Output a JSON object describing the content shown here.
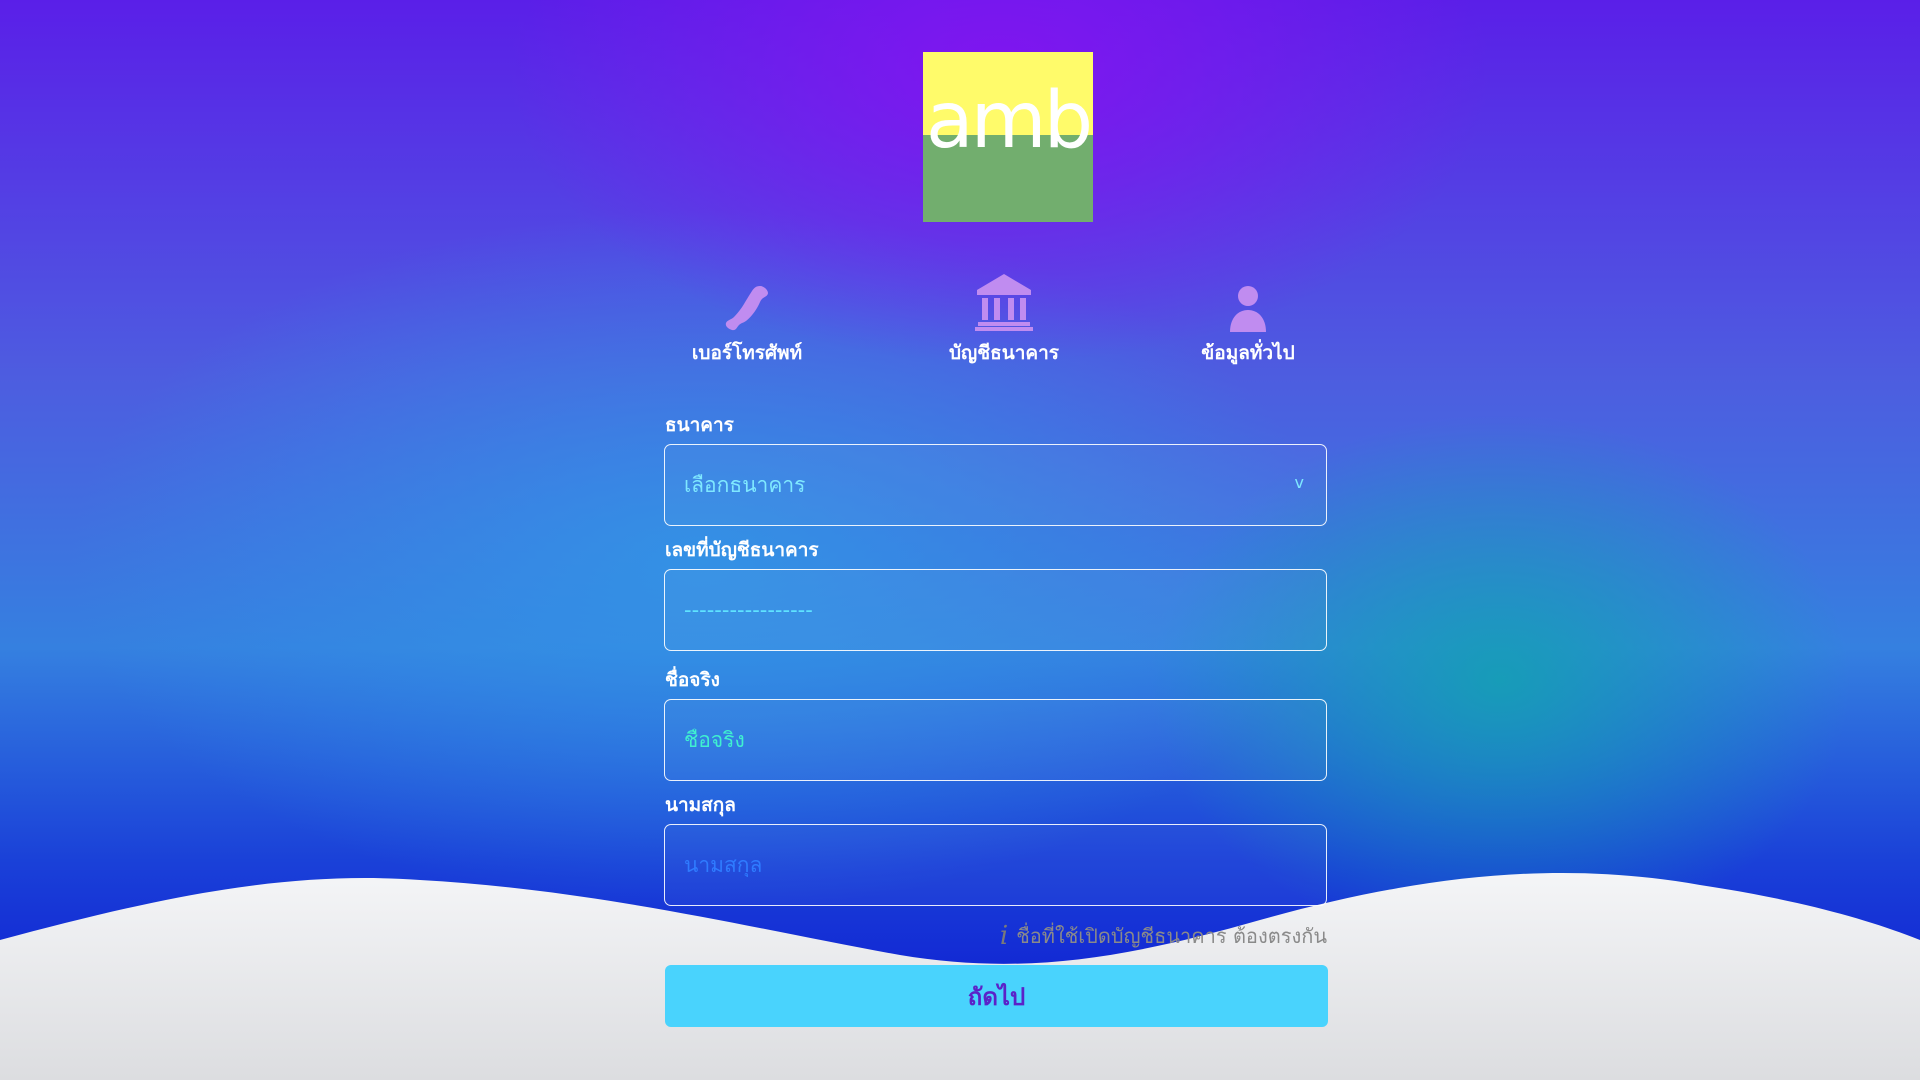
{
  "logo": {
    "text": "amb",
    "color_top": "#fffb6a",
    "color_bottom": "#72ae6e"
  },
  "steps": [
    {
      "label": "เบอร์โทรศัพท์",
      "icon": "phone-icon"
    },
    {
      "label": "บัญชีธนาคาร",
      "icon": "bank-icon"
    },
    {
      "label": "ข้อมูลทั่วไป",
      "icon": "user-icon"
    }
  ],
  "form": {
    "bank": {
      "label": "ธนาคาร",
      "selected": "เลือกธนาคาร",
      "chevron": "v"
    },
    "account_number": {
      "label": "เลขที่บัญชีธนาคาร",
      "placeholder": "-----------------"
    },
    "first_name": {
      "label": "ชื่อจริง",
      "placeholder": "ชื่อจริง"
    },
    "last_name": {
      "label": "นามสกุล",
      "placeholder": "นามสกุล"
    },
    "hint": "ชื่อที่ใช้เปิดบัญชีธนาคาร ต้องตรงกัน",
    "hint_icon": "i",
    "next_label": "ถัดไป"
  },
  "colors": {
    "accent_button": "#49d3fd",
    "button_text": "#5b22c8",
    "step_icon": "#c08cf0"
  }
}
